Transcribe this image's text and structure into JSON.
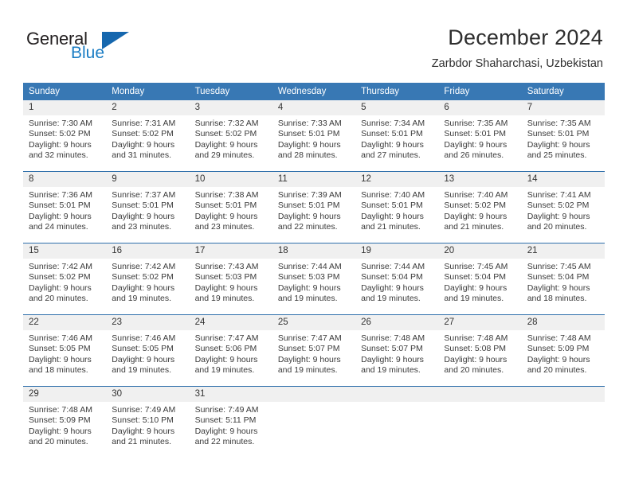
{
  "brand": {
    "name_part1": "General",
    "name_part2": "Blue",
    "accent_color": "#1a7dc4",
    "triangle_color": "#1667ae"
  },
  "header": {
    "title": "December 2024",
    "subtitle": "Zarbdor Shaharchasi, Uzbekistan"
  },
  "theme": {
    "header_row_bg": "#3878b4",
    "daynum_bg": "#f0f0f0",
    "row_border": "#2f6fab"
  },
  "weekday_headers": [
    "Sunday",
    "Monday",
    "Tuesday",
    "Wednesday",
    "Thursday",
    "Friday",
    "Saturday"
  ],
  "weeks": [
    {
      "days": [
        {
          "date": "1",
          "sunrise": "Sunrise: 7:30 AM",
          "sunset": "Sunset: 5:02 PM",
          "daylight_line1": "Daylight: 9 hours",
          "daylight_line2": "and 32 minutes."
        },
        {
          "date": "2",
          "sunrise": "Sunrise: 7:31 AM",
          "sunset": "Sunset: 5:02 PM",
          "daylight_line1": "Daylight: 9 hours",
          "daylight_line2": "and 31 minutes."
        },
        {
          "date": "3",
          "sunrise": "Sunrise: 7:32 AM",
          "sunset": "Sunset: 5:02 PM",
          "daylight_line1": "Daylight: 9 hours",
          "daylight_line2": "and 29 minutes."
        },
        {
          "date": "4",
          "sunrise": "Sunrise: 7:33 AM",
          "sunset": "Sunset: 5:01 PM",
          "daylight_line1": "Daylight: 9 hours",
          "daylight_line2": "and 28 minutes."
        },
        {
          "date": "5",
          "sunrise": "Sunrise: 7:34 AM",
          "sunset": "Sunset: 5:01 PM",
          "daylight_line1": "Daylight: 9 hours",
          "daylight_line2": "and 27 minutes."
        },
        {
          "date": "6",
          "sunrise": "Sunrise: 7:35 AM",
          "sunset": "Sunset: 5:01 PM",
          "daylight_line1": "Daylight: 9 hours",
          "daylight_line2": "and 26 minutes."
        },
        {
          "date": "7",
          "sunrise": "Sunrise: 7:35 AM",
          "sunset": "Sunset: 5:01 PM",
          "daylight_line1": "Daylight: 9 hours",
          "daylight_line2": "and 25 minutes."
        }
      ]
    },
    {
      "days": [
        {
          "date": "8",
          "sunrise": "Sunrise: 7:36 AM",
          "sunset": "Sunset: 5:01 PM",
          "daylight_line1": "Daylight: 9 hours",
          "daylight_line2": "and 24 minutes."
        },
        {
          "date": "9",
          "sunrise": "Sunrise: 7:37 AM",
          "sunset": "Sunset: 5:01 PM",
          "daylight_line1": "Daylight: 9 hours",
          "daylight_line2": "and 23 minutes."
        },
        {
          "date": "10",
          "sunrise": "Sunrise: 7:38 AM",
          "sunset": "Sunset: 5:01 PM",
          "daylight_line1": "Daylight: 9 hours",
          "daylight_line2": "and 23 minutes."
        },
        {
          "date": "11",
          "sunrise": "Sunrise: 7:39 AM",
          "sunset": "Sunset: 5:01 PM",
          "daylight_line1": "Daylight: 9 hours",
          "daylight_line2": "and 22 minutes."
        },
        {
          "date": "12",
          "sunrise": "Sunrise: 7:40 AM",
          "sunset": "Sunset: 5:01 PM",
          "daylight_line1": "Daylight: 9 hours",
          "daylight_line2": "and 21 minutes."
        },
        {
          "date": "13",
          "sunrise": "Sunrise: 7:40 AM",
          "sunset": "Sunset: 5:02 PM",
          "daylight_line1": "Daylight: 9 hours",
          "daylight_line2": "and 21 minutes."
        },
        {
          "date": "14",
          "sunrise": "Sunrise: 7:41 AM",
          "sunset": "Sunset: 5:02 PM",
          "daylight_line1": "Daylight: 9 hours",
          "daylight_line2": "and 20 minutes."
        }
      ]
    },
    {
      "days": [
        {
          "date": "15",
          "sunrise": "Sunrise: 7:42 AM",
          "sunset": "Sunset: 5:02 PM",
          "daylight_line1": "Daylight: 9 hours",
          "daylight_line2": "and 20 minutes."
        },
        {
          "date": "16",
          "sunrise": "Sunrise: 7:42 AM",
          "sunset": "Sunset: 5:02 PM",
          "daylight_line1": "Daylight: 9 hours",
          "daylight_line2": "and 19 minutes."
        },
        {
          "date": "17",
          "sunrise": "Sunrise: 7:43 AM",
          "sunset": "Sunset: 5:03 PM",
          "daylight_line1": "Daylight: 9 hours",
          "daylight_line2": "and 19 minutes."
        },
        {
          "date": "18",
          "sunrise": "Sunrise: 7:44 AM",
          "sunset": "Sunset: 5:03 PM",
          "daylight_line1": "Daylight: 9 hours",
          "daylight_line2": "and 19 minutes."
        },
        {
          "date": "19",
          "sunrise": "Sunrise: 7:44 AM",
          "sunset": "Sunset: 5:04 PM",
          "daylight_line1": "Daylight: 9 hours",
          "daylight_line2": "and 19 minutes."
        },
        {
          "date": "20",
          "sunrise": "Sunrise: 7:45 AM",
          "sunset": "Sunset: 5:04 PM",
          "daylight_line1": "Daylight: 9 hours",
          "daylight_line2": "and 19 minutes."
        },
        {
          "date": "21",
          "sunrise": "Sunrise: 7:45 AM",
          "sunset": "Sunset: 5:04 PM",
          "daylight_line1": "Daylight: 9 hours",
          "daylight_line2": "and 18 minutes."
        }
      ]
    },
    {
      "days": [
        {
          "date": "22",
          "sunrise": "Sunrise: 7:46 AM",
          "sunset": "Sunset: 5:05 PM",
          "daylight_line1": "Daylight: 9 hours",
          "daylight_line2": "and 18 minutes."
        },
        {
          "date": "23",
          "sunrise": "Sunrise: 7:46 AM",
          "sunset": "Sunset: 5:05 PM",
          "daylight_line1": "Daylight: 9 hours",
          "daylight_line2": "and 19 minutes."
        },
        {
          "date": "24",
          "sunrise": "Sunrise: 7:47 AM",
          "sunset": "Sunset: 5:06 PM",
          "daylight_line1": "Daylight: 9 hours",
          "daylight_line2": "and 19 minutes."
        },
        {
          "date": "25",
          "sunrise": "Sunrise: 7:47 AM",
          "sunset": "Sunset: 5:07 PM",
          "daylight_line1": "Daylight: 9 hours",
          "daylight_line2": "and 19 minutes."
        },
        {
          "date": "26",
          "sunrise": "Sunrise: 7:48 AM",
          "sunset": "Sunset: 5:07 PM",
          "daylight_line1": "Daylight: 9 hours",
          "daylight_line2": "and 19 minutes."
        },
        {
          "date": "27",
          "sunrise": "Sunrise: 7:48 AM",
          "sunset": "Sunset: 5:08 PM",
          "daylight_line1": "Daylight: 9 hours",
          "daylight_line2": "and 20 minutes."
        },
        {
          "date": "28",
          "sunrise": "Sunrise: 7:48 AM",
          "sunset": "Sunset: 5:09 PM",
          "daylight_line1": "Daylight: 9 hours",
          "daylight_line2": "and 20 minutes."
        }
      ]
    },
    {
      "days": [
        {
          "date": "29",
          "sunrise": "Sunrise: 7:48 AM",
          "sunset": "Sunset: 5:09 PM",
          "daylight_line1": "Daylight: 9 hours",
          "daylight_line2": "and 20 minutes."
        },
        {
          "date": "30",
          "sunrise": "Sunrise: 7:49 AM",
          "sunset": "Sunset: 5:10 PM",
          "daylight_line1": "Daylight: 9 hours",
          "daylight_line2": "and 21 minutes."
        },
        {
          "date": "31",
          "sunrise": "Sunrise: 7:49 AM",
          "sunset": "Sunset: 5:11 PM",
          "daylight_line1": "Daylight: 9 hours",
          "daylight_line2": "and 22 minutes."
        },
        {
          "date": "",
          "sunrise": "",
          "sunset": "",
          "daylight_line1": "",
          "daylight_line2": ""
        },
        {
          "date": "",
          "sunrise": "",
          "sunset": "",
          "daylight_line1": "",
          "daylight_line2": ""
        },
        {
          "date": "",
          "sunrise": "",
          "sunset": "",
          "daylight_line1": "",
          "daylight_line2": ""
        },
        {
          "date": "",
          "sunrise": "",
          "sunset": "",
          "daylight_line1": "",
          "daylight_line2": ""
        }
      ]
    }
  ]
}
